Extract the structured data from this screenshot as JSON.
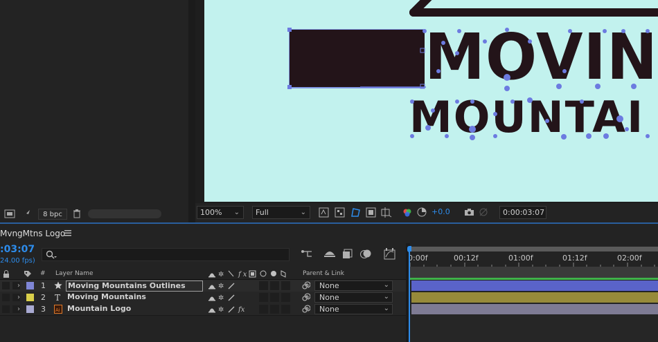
{
  "project_panel": {
    "bit_depth": "8 bpc"
  },
  "viewer": {
    "zoom": "100%",
    "resolution": "Full",
    "exposure": "+0.0",
    "timecode": "0:00:03:07",
    "logo_line1": "MOVIN",
    "logo_line2": "MOUNTAI"
  },
  "timeline": {
    "comp_name": "MvngMtns Logo",
    "current_time": ":03:07",
    "fps": "24.00 fps)",
    "search_placeholder": "",
    "headers": {
      "num": "#",
      "layer_name": "Layer Name",
      "parent_link": "Parent & Link"
    },
    "ruler_ticks": [
      "0:00f",
      "00:12f",
      "01:00f",
      "01:12f",
      "02:00f"
    ],
    "layers": [
      {
        "num": "1",
        "name": "Moving Mountains Outlines",
        "type_icon": "star-shape-icon",
        "label_color": "#7f86d6",
        "parent": "None",
        "bar_color": "#5a63c9"
      },
      {
        "num": "2",
        "name": "Moving Mountains",
        "type_icon": "text-layer-icon",
        "label_color": "#d9cf4a",
        "parent": "None",
        "bar_color": "#978a3a"
      },
      {
        "num": "3",
        "name": "Mountain Logo",
        "type_icon": "ai-file-icon",
        "label_color": "#a9aad2",
        "parent": "None",
        "bar_color": "#7e7b94"
      }
    ]
  },
  "colors": {
    "canvas_bg": "#c2f2ee",
    "logo_fill": "#231419",
    "accent_blue": "#2d8ceb",
    "work_area_green": "#3fb24a"
  }
}
